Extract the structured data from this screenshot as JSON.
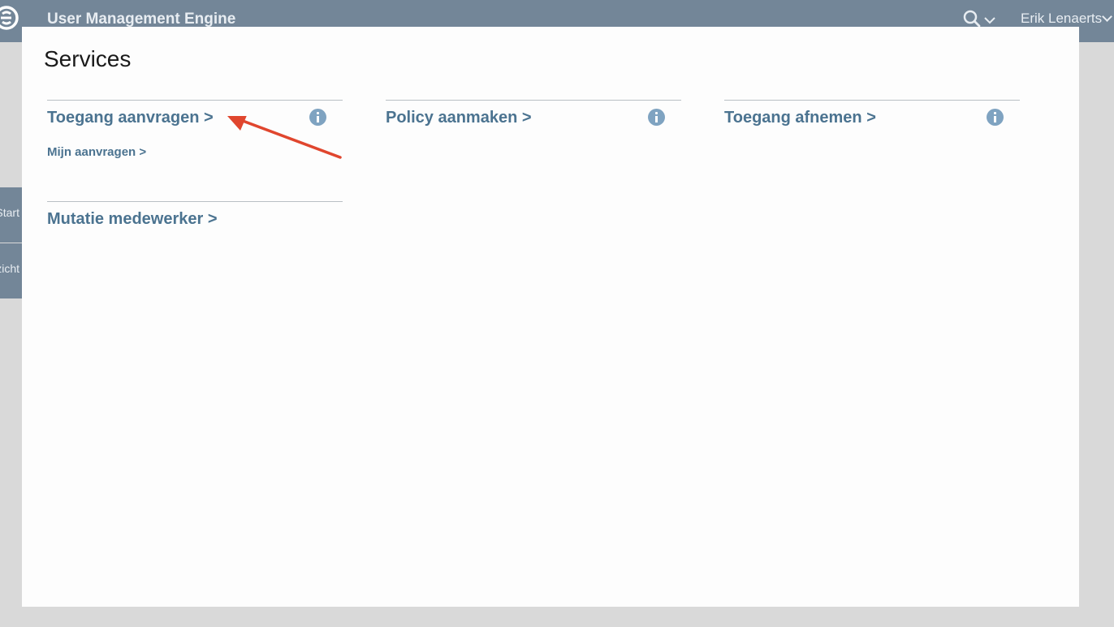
{
  "header": {
    "app_title": "User Management Engine",
    "user_name": "Erik Lenaerts"
  },
  "sidebar": {
    "tabs": [
      {
        "label": "Start"
      },
      {
        "label": "Overzicht"
      }
    ]
  },
  "modal": {
    "title": "Services",
    "services": [
      {
        "label": "Toegang aanvragen >",
        "sub_link": "Mijn aanvragen >"
      },
      {
        "label": "Policy aanmaken >"
      },
      {
        "label": "Toegang afnemen >"
      },
      {
        "label": "Mutatie medewerker >"
      }
    ]
  },
  "colors": {
    "header_bg": "#738698",
    "link": "#4b7390",
    "info_icon": "#7fa3c1",
    "annotation_arrow": "#e0462e"
  },
  "icons": {
    "logo": "logo-icon",
    "search": "search-icon",
    "info": "info-icon"
  }
}
